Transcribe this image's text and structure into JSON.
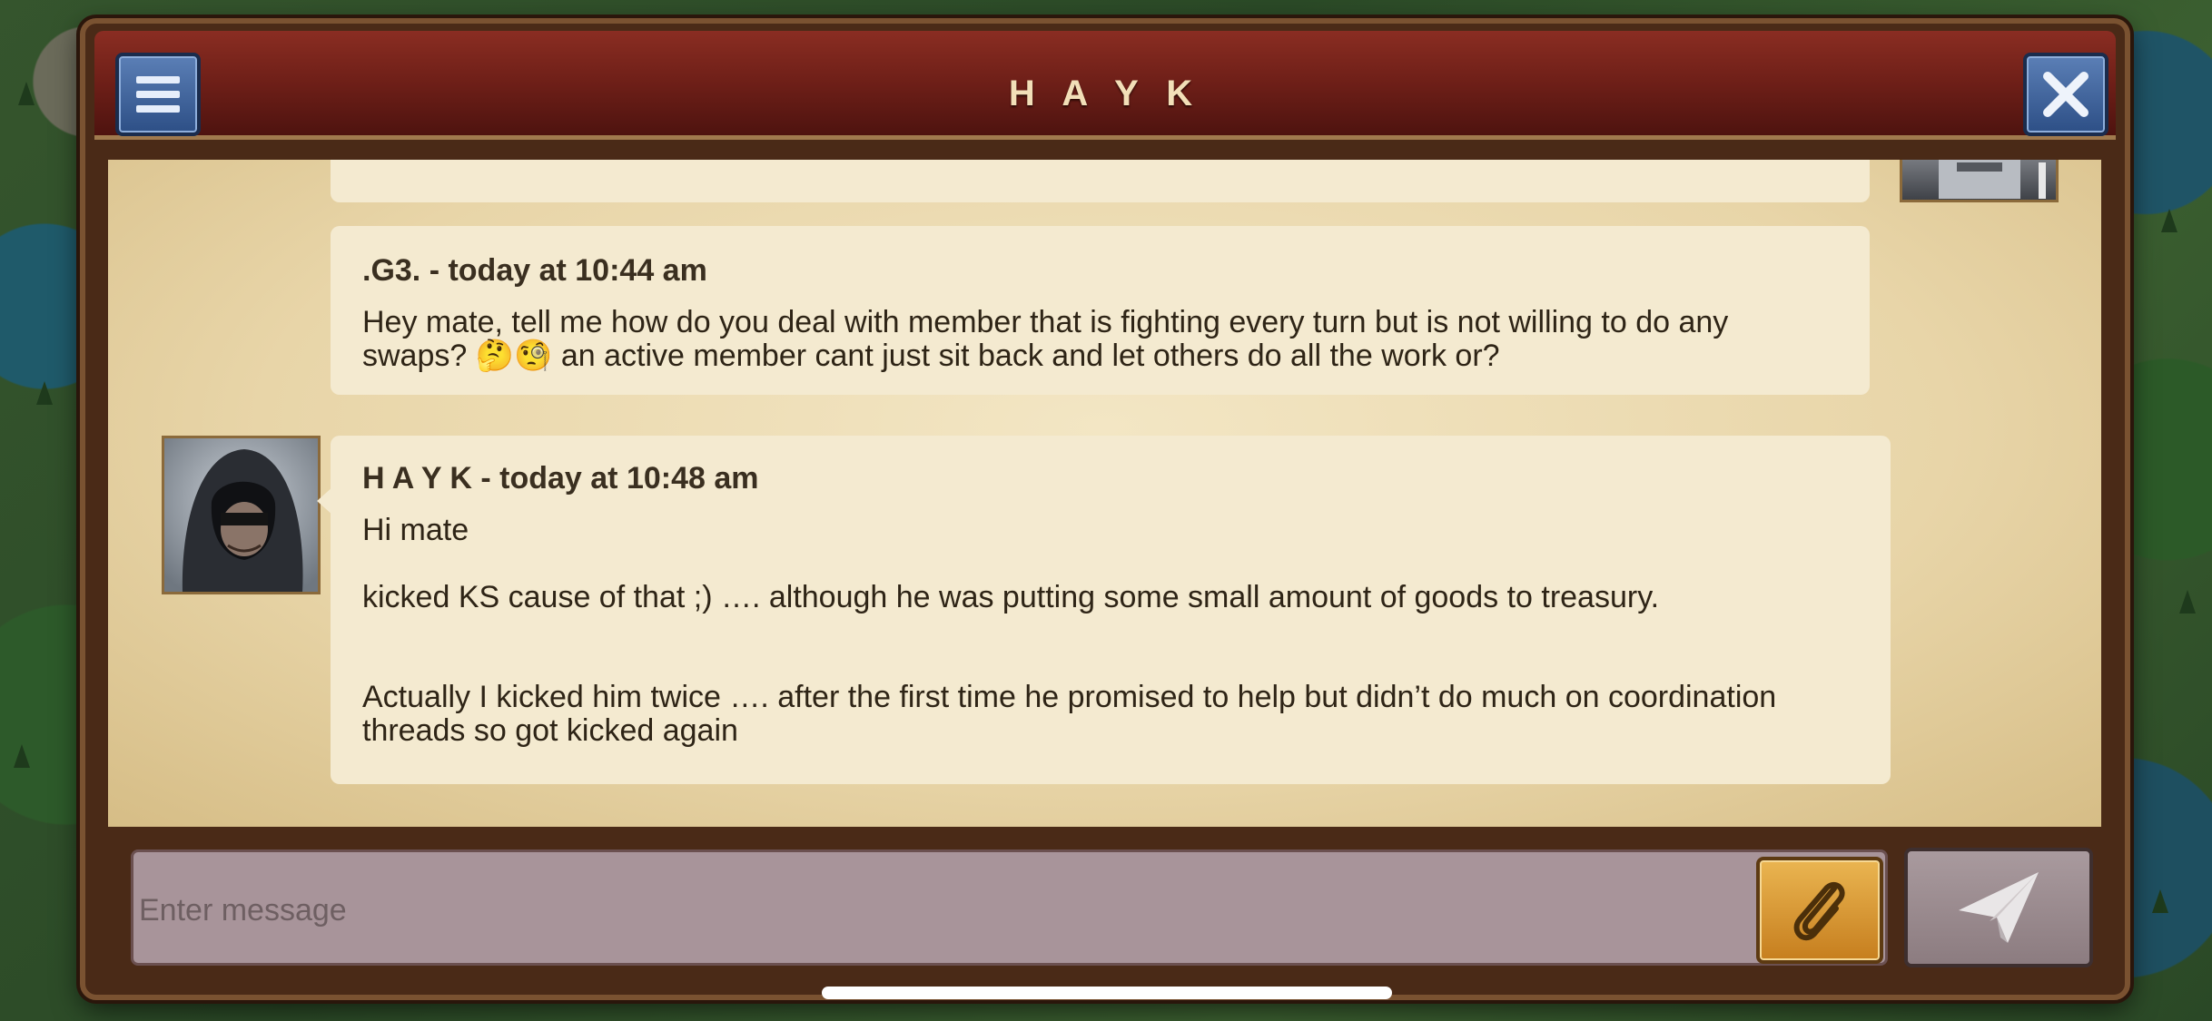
{
  "window": {
    "title": "H A Y K"
  },
  "messages": [
    {
      "author_time": ".G3. - today at 10:44 am",
      "text": "Hey mate, tell me how do you deal with member that is fighting every turn  but is not willing to do any swaps? 🤔🧐 an active member cant just sit back and let others do all the work or?"
    },
    {
      "author_time": "H A Y K - today at 10:48 am",
      "paragraphs": [
        "Hi mate",
        "kicked KS cause of that ;) …. although he was putting some small amount of goods to treasury.",
        "Actually I kicked him twice …. after the first time he promised to help but didn’t do much on coordination threads so got kicked again"
      ]
    }
  ],
  "composer": {
    "placeholder": "Enter message"
  },
  "icons": {
    "menu": "hamburger-menu-icon",
    "close": "close-x-icon",
    "attach": "paperclip-icon",
    "send": "paper-plane-icon"
  },
  "colors": {
    "title_bar": "#6e1f18",
    "frame": "#4a2a17",
    "parchment": "#f4ead0",
    "blue_button": "#2d4f86",
    "attach_button": "#d8992f"
  }
}
